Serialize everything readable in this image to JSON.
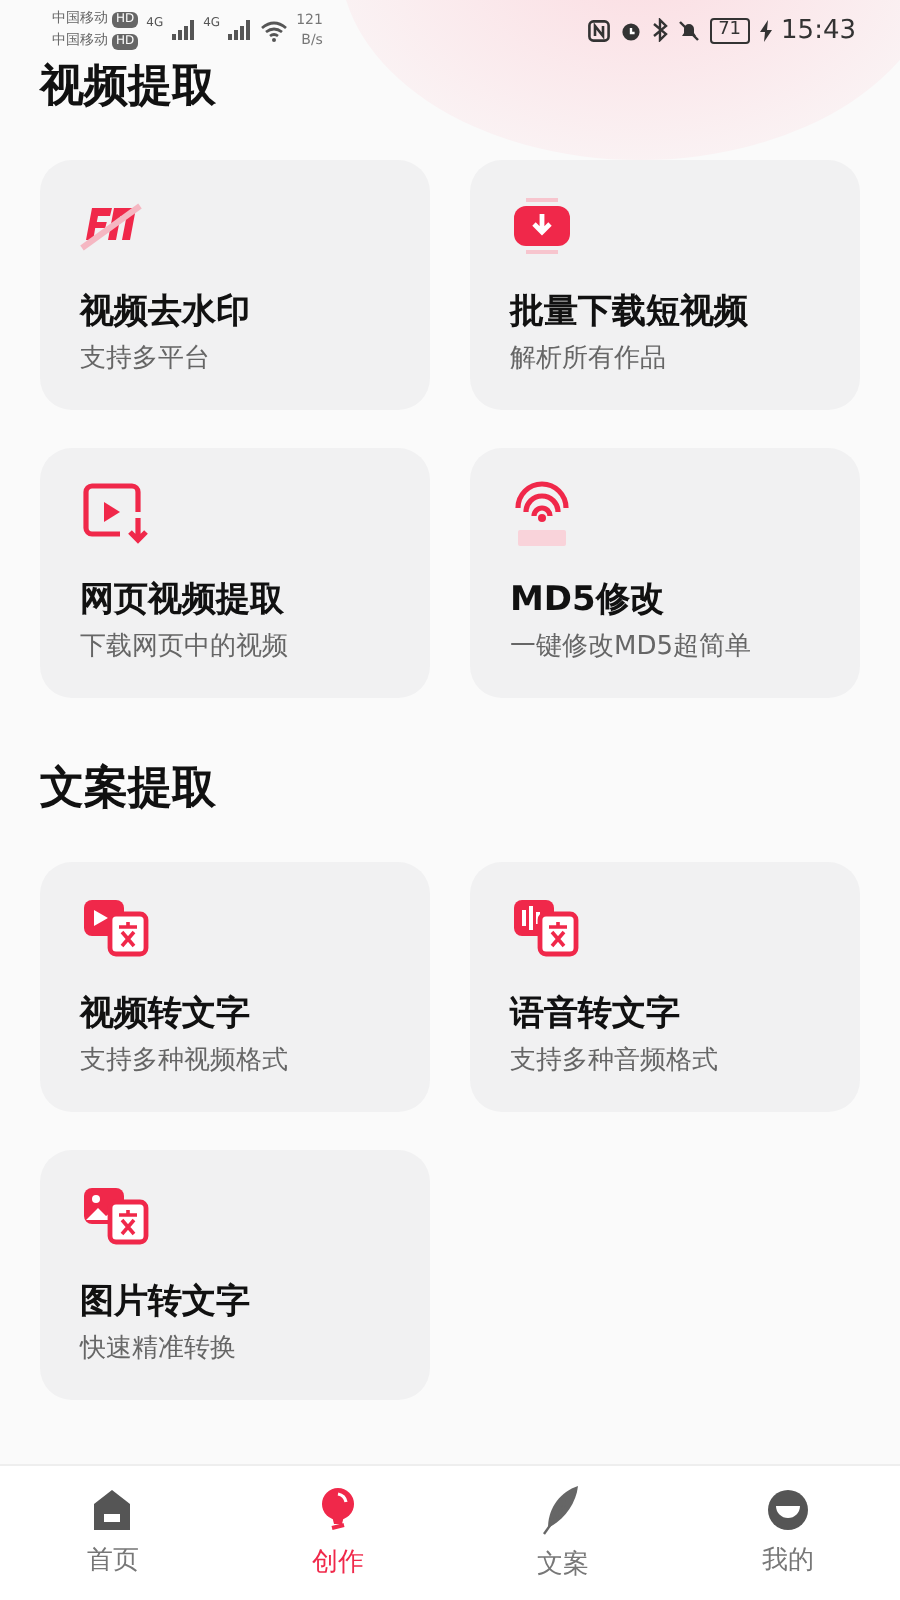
{
  "status_bar": {
    "carriers": [
      {
        "name": "中国移动",
        "badge": "HD"
      },
      {
        "name": "中国移动",
        "badge": "HD"
      }
    ],
    "network": [
      "4G",
      "4G"
    ],
    "speed_value": "121",
    "speed_unit": "B/s",
    "battery": "71",
    "time": "15:43"
  },
  "sections": [
    {
      "title": "视频提取",
      "cards": [
        {
          "kind": "watermark",
          "title": "视频去水印",
          "subtitle": "支持多平台"
        },
        {
          "kind": "download",
          "title": "批量下载短视频",
          "subtitle": "解析所有作品"
        },
        {
          "kind": "web",
          "title": "网页视频提取",
          "subtitle": "下载网页中的视频"
        },
        {
          "kind": "md5",
          "title": "MD5修改",
          "subtitle": "一键修改MD5超简单"
        }
      ]
    },
    {
      "title": "文案提取",
      "cards": [
        {
          "kind": "video-text",
          "title": "视频转文字",
          "subtitle": "支持多种视频格式"
        },
        {
          "kind": "audio-text",
          "title": "语音转文字",
          "subtitle": "支持多种音频格式"
        },
        {
          "kind": "image-text",
          "title": "图片转文字",
          "subtitle": "快速精准转换"
        }
      ]
    }
  ],
  "tabs": [
    {
      "kind": "home",
      "label": "首页",
      "selected": false
    },
    {
      "kind": "create",
      "label": "创作",
      "selected": true
    },
    {
      "kind": "copy",
      "label": "文案",
      "selected": false
    },
    {
      "kind": "me",
      "label": "我的",
      "selected": false
    }
  ]
}
